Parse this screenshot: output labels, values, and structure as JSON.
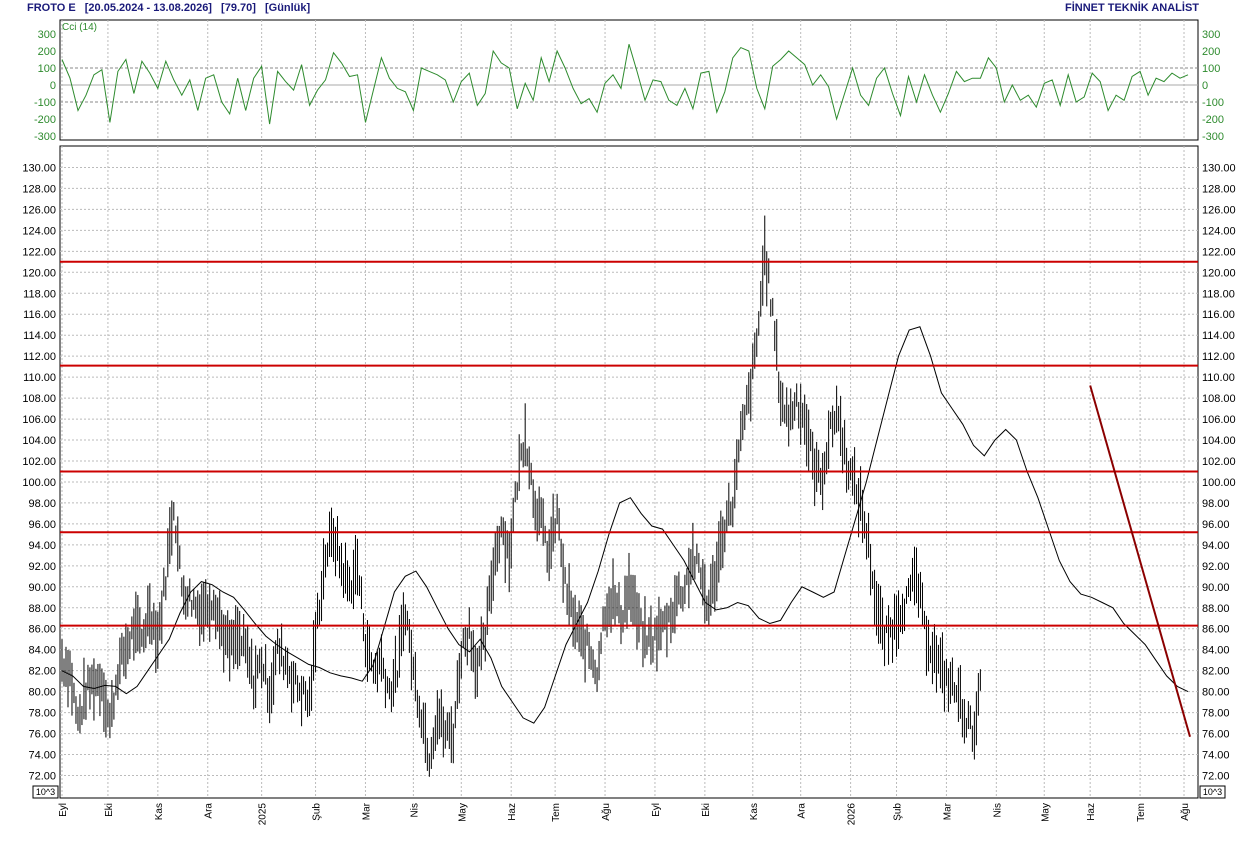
{
  "header": {
    "symbol": "FROTO E",
    "range": "[20.05.2024 - 13.08.2026]",
    "last": "[79.70]",
    "period": "[Günlük]",
    "brand": "FİNNET TEKNİK ANALİST"
  },
  "colors": {
    "price": "#000000",
    "ma": "#000000",
    "cci": "#2e8b2e",
    "levels": "#cc0000",
    "trend": "#8b0000",
    "grid": "#bbbbbb",
    "header_text": "#1a1a7a"
  },
  "chart_data": [
    {
      "type": "line",
      "indicator": true,
      "series": [
        {
          "name": "Cci (14)",
          "x": [
            0,
            4,
            8,
            12,
            16,
            20,
            24,
            28,
            32,
            36,
            40,
            44,
            48,
            52,
            56,
            60,
            64,
            68,
            72,
            76,
            80,
            84,
            88,
            92,
            96,
            100,
            104,
            108,
            112,
            116,
            120,
            124,
            128,
            132,
            136,
            140,
            144,
            148,
            152,
            156,
            160,
            164,
            168,
            172,
            176,
            180,
            184,
            188,
            192,
            196,
            200,
            204,
            208,
            212,
            216,
            220,
            224,
            228,
            232,
            236,
            240,
            244,
            248,
            252,
            256,
            260,
            264,
            268,
            272,
            276,
            280,
            284,
            288,
            292,
            296,
            300,
            304,
            308,
            312,
            316,
            320,
            324,
            328,
            332,
            336,
            340,
            344,
            348,
            352,
            356,
            360,
            364,
            368,
            372,
            376,
            380,
            384,
            388,
            392,
            396,
            400,
            404,
            408,
            412,
            416,
            420,
            424,
            428,
            432,
            436,
            440,
            444,
            448,
            452,
            456,
            460,
            464,
            468,
            472,
            476,
            480,
            484,
            488,
            492,
            496,
            500,
            504,
            508,
            512,
            516,
            520,
            524,
            528,
            532,
            536,
            540,
            544,
            548,
            552,
            556,
            560,
            564
          ],
          "values": [
            150,
            40,
            -150,
            -60,
            60,
            90,
            -220,
            80,
            150,
            -50,
            140,
            70,
            -20,
            140,
            30,
            -60,
            30,
            -150,
            40,
            60,
            -100,
            -170,
            40,
            -150,
            40,
            110,
            -230,
            80,
            20,
            -30,
            120,
            -120,
            -30,
            30,
            190,
            130,
            50,
            60,
            -220,
            -30,
            160,
            40,
            -20,
            -40,
            -150,
            100,
            80,
            60,
            30,
            -100,
            20,
            70,
            -120,
            -50,
            200,
            130,
            100,
            -140,
            10,
            -90,
            160,
            20,
            200,
            100,
            -20,
            -110,
            -80,
            -160,
            10,
            60,
            -20,
            240,
            80,
            -90,
            30,
            20,
            -90,
            -120,
            -20,
            -140,
            70,
            80,
            -160,
            -40,
            160,
            220,
            200,
            -20,
            -140,
            110,
            150,
            200,
            160,
            120,
            0,
            60,
            -10,
            -200,
            -50,
            100,
            -60,
            -120,
            40,
            100,
            -50,
            -180,
            50,
            -100,
            60,
            -60,
            -160,
            -50,
            80,
            20,
            40,
            40,
            160,
            100,
            -100,
            0,
            -90,
            -60,
            -130,
            10,
            30,
            -120,
            60,
            -100,
            -70,
            70,
            20,
            -150,
            -60,
            -90,
            50,
            80,
            -60,
            40,
            20,
            70,
            40,
            60
          ]
        }
      ],
      "xlabel": "",
      "ylabel": "",
      "ylim": [
        -300,
        300
      ],
      "yticks": [
        300,
        200,
        100,
        0,
        -100,
        -200,
        -300
      ],
      "ytick_labels": [
        "300",
        "200",
        "100",
        "0",
        "-100",
        "-200",
        "-300"
      ],
      "grid": true
    },
    {
      "type": "ohlc",
      "x_count": 565,
      "xlim": [
        0,
        565
      ],
      "x_ticks": [
        0,
        23,
        48,
        73,
        100,
        127,
        152,
        176,
        200,
        225,
        247,
        272,
        297,
        322,
        346,
        370,
        395,
        418,
        443,
        468,
        492,
        515,
        540,
        562
      ],
      "x_tick_labels": [
        "Eyl",
        "Eki",
        "Kas",
        "Ara",
        "2025",
        "Şub",
        "Mar",
        "Nis",
        "May",
        "Haz",
        "Tem",
        "Ağu",
        "Eyl",
        "Eki",
        "Kas",
        "Ara",
        "2026",
        "Şub",
        "Mar",
        "Nis",
        "May",
        "Haz",
        "Tem",
        "Ağu"
      ],
      "close_path": {
        "x": [
          0,
          4,
          8,
          12,
          16,
          20,
          24,
          28,
          32,
          36,
          40,
          44,
          48,
          52,
          56,
          60,
          64,
          68,
          72,
          76,
          80,
          84,
          88,
          92,
          96,
          100,
          104,
          108,
          112,
          116,
          120,
          124,
          128,
          132,
          136,
          140,
          144,
          148,
          152,
          156,
          160,
          164,
          168,
          172,
          176,
          180,
          184,
          188,
          192,
          196,
          200,
          204,
          208,
          212,
          216,
          220,
          224,
          228,
          232,
          236,
          240,
          244,
          248,
          252,
          256,
          260,
          264,
          268,
          272,
          276,
          280,
          284,
          288,
          292,
          296,
          300,
          304,
          308,
          312,
          316,
          320,
          324,
          328,
          332,
          336,
          340,
          344,
          348,
          352,
          356,
          360,
          364,
          368,
          372,
          376,
          380,
          384,
          388,
          392,
          396,
          400,
          404,
          408,
          412,
          416,
          420,
          424,
          428,
          432,
          436,
          440,
          444,
          448,
          452,
          456,
          460,
          464,
          468,
          472,
          476,
          480,
          484,
          488,
          492,
          496,
          500,
          504,
          508,
          512,
          516,
          520,
          524,
          528,
          532,
          536,
          540,
          544,
          548,
          552,
          556,
          560,
          564
        ],
        "values": [
          83,
          82,
          77,
          80,
          81,
          81,
          77,
          82,
          84,
          86,
          85,
          88,
          85,
          91,
          98,
          90,
          89,
          88,
          88,
          89,
          86,
          84,
          85,
          84,
          81,
          83,
          80,
          84,
          83,
          81,
          80,
          79,
          87,
          93,
          95,
          92,
          90,
          92,
          85,
          82,
          83,
          80,
          82,
          88,
          82,
          78,
          74,
          78,
          76,
          76,
          84,
          86,
          82,
          85,
          92,
          96,
          93,
          100,
          105,
          99,
          96,
          93,
          97,
          90,
          87,
          85,
          84,
          82,
          88,
          89,
          87,
          90,
          87,
          85,
          85,
          86,
          87,
          89,
          90,
          93,
          91,
          88,
          92,
          96,
          98,
          104,
          108,
          113,
          122,
          116,
          108,
          106,
          108,
          106,
          102,
          100,
          104,
          107,
          103,
          100,
          98,
          94,
          88,
          85,
          86,
          88,
          89,
          91,
          86,
          84,
          82,
          81,
          80,
          78,
          76,
          80
        ]
      },
      "ma_values": [
        82,
        81.5,
        80.5,
        80.3,
        80.6,
        80.5,
        79.8,
        80.5,
        82.0,
        83.5,
        85.0,
        87.5,
        89.5,
        90.5,
        90.2,
        89.5,
        89.0,
        87.8,
        86.5,
        85.3,
        84.5,
        83.8,
        83.2,
        82.6,
        82.3,
        81.8,
        81.5,
        81.3,
        81.0,
        82.5,
        86.0,
        89.5,
        91.0,
        91.5,
        90.0,
        88.0,
        86.0,
        84.5,
        83.8,
        85.0,
        83.2,
        80.5,
        79.0,
        77.5,
        77.0,
        78.5,
        81.5,
        84.5,
        86.5,
        88.5,
        91.5,
        95.0,
        98.0,
        98.5,
        97.0,
        95.8,
        95.5,
        94.0,
        92.5,
        90.5,
        88.5,
        87.8,
        88.0,
        88.5,
        88.2,
        87.0,
        86.5,
        86.8,
        88.5,
        90.0,
        89.5,
        89.0,
        89.5,
        93.0,
        96.5,
        100.0,
        104.0,
        108.0,
        112.0,
        114.5,
        114.8,
        112.0,
        108.5,
        107.0,
        105.5,
        103.5,
        102.5,
        104.0,
        105.0,
        104.0,
        101.0,
        98.5,
        95.5,
        92.5,
        90.5,
        89.3,
        89.0,
        88.5,
        88.0,
        86.5,
        85.5,
        84.5,
        83.0,
        81.5,
        80.5,
        80.0
      ],
      "ylim": [
        71,
        133
      ],
      "yticks": [
        72,
        74,
        76,
        78,
        80,
        82,
        84,
        86,
        88,
        90,
        92,
        94,
        96,
        98,
        100,
        102,
        104,
        106,
        108,
        110,
        112,
        114,
        116,
        118,
        120,
        122,
        124,
        126,
        128,
        130
      ],
      "ytick_labels": [
        "72.00",
        "74.00",
        "76.00",
        "78.00",
        "80.00",
        "82.00",
        "84.00",
        "86.00",
        "88.00",
        "90.00",
        "92.00",
        "94.00",
        "96.00",
        "98.00",
        "100.00",
        "102.00",
        "104.00",
        "106.00",
        "108.00",
        "110.00",
        "112.00",
        "114.00",
        "116.00",
        "118.00",
        "120.00",
        "122.00",
        "124.00",
        "126.00",
        "128.00",
        "130.00"
      ],
      "scale_label": "10^3",
      "h_levels": [
        121.0,
        111.1,
        101.0,
        95.2,
        86.3
      ],
      "trendline": {
        "x": [
          515,
          565
        ],
        "y": [
          109.2,
          75.7
        ]
      },
      "grid": true,
      "xlabel": "",
      "ylabel": ""
    }
  ]
}
